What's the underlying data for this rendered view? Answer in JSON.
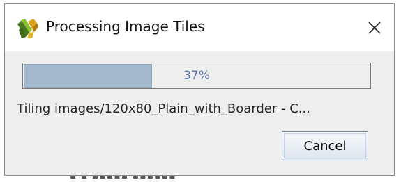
{
  "window": {
    "title": "Processing Image Tiles",
    "app_icon": "app-logo-icon",
    "close_icon": "close-icon"
  },
  "progress": {
    "value": 0.37,
    "label": "37%",
    "fill_color": "#a3b8cc",
    "label_color": "#5a73b0"
  },
  "status": {
    "text": "Tiling images/120x80_Plain_with_Boarder - C..."
  },
  "buttons": {
    "cancel_label": "Cancel"
  }
}
